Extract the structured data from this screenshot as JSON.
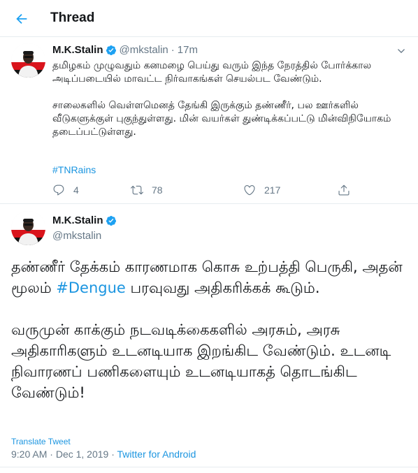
{
  "header": {
    "title": "Thread",
    "back_icon": "back-arrow-icon",
    "accent_color": "#1da1f2"
  },
  "tweet1": {
    "name": "M.K.Stalin",
    "handle": "@mkstalin",
    "separator": "·",
    "time": "17m",
    "verified_icon": "verified-badge-icon",
    "paragraphs": [
      "தமிழகம் முழுவதும் கனமழை பெய்து வரும் இந்த நேரத்தில் போர்க்கால அடிப்படையில் மாவட்ட நிர்வாகங்கள் செயல்பட வேண்டும்.",
      "சாலைகளில் வெள்ளமெனத் தேங்கி இருக்கும் தண்ணீர், பல ஊர்களில் வீடுகளுக்குள் புகுந்துள்ளது. மின் வயர்கள் துண்டிக்கப்பட்டு மின்விநியோகம் தடைப்பட்டுள்ளது."
    ],
    "hashtag": "#TNRains",
    "actions": {
      "reply_count": "4",
      "retweet_count": "78",
      "like_count": "217"
    }
  },
  "tweet2": {
    "name": "M.K.Stalin",
    "handle": "@mkstalin",
    "para1_before": "தண்ணீர் தேக்கம் காரணமாக கொசு உற்பத்தி பெருகி, அதன் மூலம் ",
    "para1_hashtag": "#Dengue",
    "para1_after": " பரவுவது அதிகரிக்கக் கூடும்.",
    "para2": "வருமுன் காக்கும் நடவடிக்கைகளில் அரசும், அரசு அதிகாரிகளும் உடனடியாக இறங்கிட வேண்டும். உடனடி நிவாரணப் பணிகளையும் உடனடியாகத் தொடங்கிட வேண்டும்!",
    "translate_label": "Translate Tweet",
    "time": "9:20 AM",
    "dot": "·",
    "date": "Dec 1, 2019",
    "source": "Twitter for Android"
  },
  "colors": {
    "link": "#1b95e0",
    "muted": "#657786",
    "border": "#e6ecf0"
  }
}
